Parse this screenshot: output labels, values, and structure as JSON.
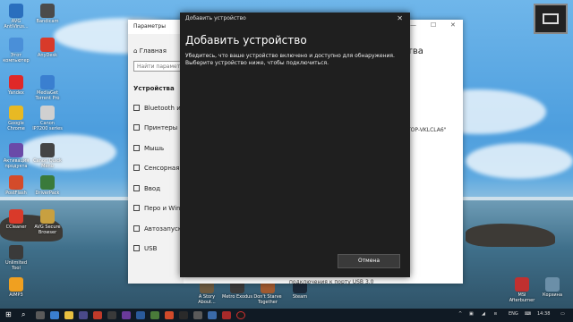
{
  "desktop": {
    "icons_left": [
      {
        "label": "AVG AntiVirus...",
        "color": "#2a6fbe"
      },
      {
        "label": "Этот компьютер",
        "color": "#4a8fd8"
      },
      {
        "label": "Yandex",
        "color": "#e02828"
      },
      {
        "label": "Google Chrome",
        "color": "#e8b923"
      },
      {
        "label": "Активация продукта",
        "color": "#6a4aa8"
      },
      {
        "label": "PostFlash",
        "color": "#d44b2a"
      },
      {
        "label": "CCleaner",
        "color": "#d93a2a"
      },
      {
        "label": "Unlimited Tool",
        "color": "#3a3a3a"
      },
      {
        "label": "AIMP3",
        "color": "#f0a020"
      }
    ],
    "icons_col2": [
      {
        "label": "Bandicam",
        "color": "#4b4b4b"
      },
      {
        "label": "AnyDesk",
        "color": "#d83a2a"
      },
      {
        "label": "MediaGet Torrent Pro",
        "color": "#3a7fd0"
      },
      {
        "label": "Canon IP7200 series",
        "color": "#d0d0d0"
      },
      {
        "label": "Canon Quick Menu",
        "color": "#444444"
      },
      {
        "label": "DriverPack",
        "color": "#3a7a3a"
      },
      {
        "label": "AVG Secure Browser",
        "color": "#c8a040"
      }
    ],
    "icons_bottom": [
      {
        "label": "A Story About...",
        "color": "#6c5a40"
      },
      {
        "label": "Metro Exodus",
        "color": "#3a3a3a"
      },
      {
        "label": "Don't Starve Together",
        "color": "#a05a30"
      },
      {
        "label": "Steam",
        "color": "#1b2838"
      }
    ],
    "icons_right": [
      {
        "label": "MSI Afterburner",
        "color": "#c03030"
      },
      {
        "label": "Корзина",
        "color": "#6b8fa8"
      }
    ]
  },
  "settings_window": {
    "title": "Параметры",
    "home_label": "Главная",
    "search_placeholder": "Найти параметр",
    "section_label": "Устройства",
    "nav_items": [
      {
        "label": "Bluetooth и"
      },
      {
        "label": "Принтеры и"
      },
      {
        "label": "Мышь"
      },
      {
        "label": "Сенсорная"
      },
      {
        "label": "Ввод"
      },
      {
        "label": "Перо и Win"
      },
      {
        "label": "Автозапуск"
      },
      {
        "label": "USB"
      }
    ],
    "right_text_top": "тва",
    "right_text_mid": "TOP-VKLCLA6\"",
    "bottom_text": "подключения к порту USB 3.0"
  },
  "dialog": {
    "title": "Добавить устройство",
    "heading": "Добавить устройство",
    "body": "Убедитесь, что ваше устройство включено и доступно для обнаружения. Выберите устройство ниже, чтобы подключиться.",
    "cancel_label": "Отмена"
  },
  "taskbar": {
    "language": "ENG",
    "time": "14:38"
  }
}
